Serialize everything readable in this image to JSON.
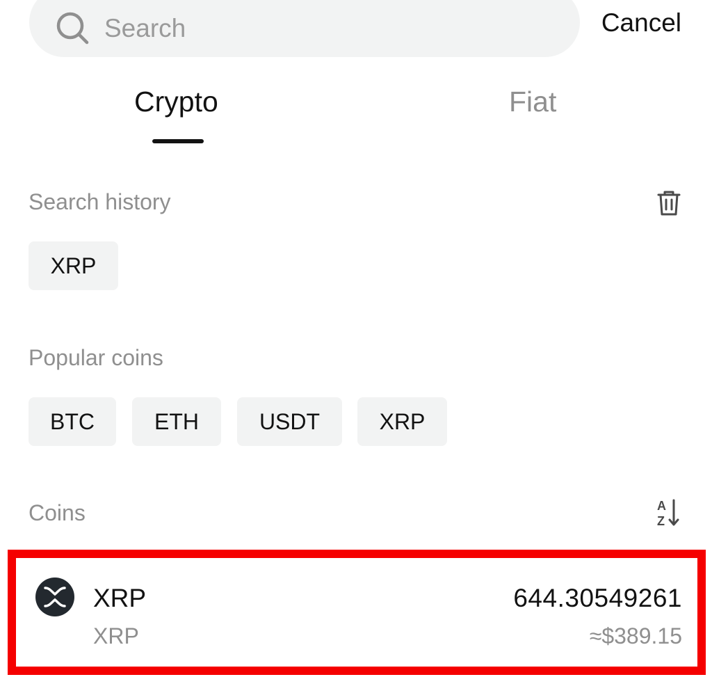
{
  "search": {
    "placeholder": "Search",
    "value": "",
    "icon": "search-icon",
    "cancel_label": "Cancel"
  },
  "tabs": [
    {
      "label": "Crypto",
      "active": true
    },
    {
      "label": "Fiat",
      "active": false
    }
  ],
  "search_history": {
    "title": "Search history",
    "clear_icon": "trash-icon",
    "items": [
      "XRP"
    ]
  },
  "popular_coins": {
    "title": "Popular coins",
    "items": [
      "BTC",
      "ETH",
      "USDT",
      "XRP"
    ]
  },
  "coins": {
    "title": "Coins",
    "sort_icon": "sort-alphabetical-icon",
    "items": [
      {
        "symbol": "XRP",
        "name": "XRP",
        "amount": "644.30549261",
        "usd_value": "≈$389.15",
        "logo_icon": "xrp-logo-icon"
      }
    ]
  },
  "colors": {
    "highlight_border": "#f50000",
    "chip_background": "#f2f3f3",
    "muted_text": "#8f8f8f",
    "primary_text": "#121212"
  }
}
